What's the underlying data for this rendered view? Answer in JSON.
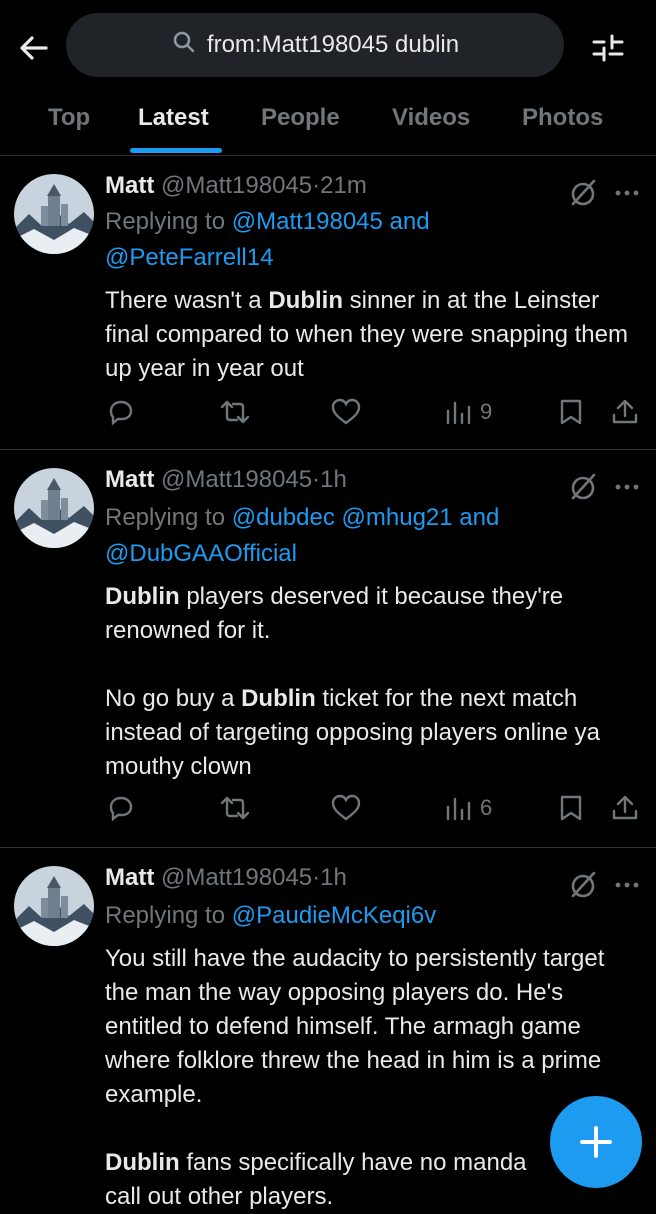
{
  "search": {
    "query": "from:Matt198045 dublin"
  },
  "tabs": [
    {
      "label": "Top"
    },
    {
      "label": "Latest"
    },
    {
      "label": "People"
    },
    {
      "label": "Videos"
    },
    {
      "label": "Photos"
    }
  ],
  "active_tab": "Latest",
  "tweets": [
    {
      "name": "Matt",
      "handle": "@Matt198045",
      "sep": "·",
      "time": "21m",
      "replying_prefix": "Replying to",
      "mentions": [
        "@Matt198045",
        "@PeteFarrell14"
      ],
      "connector": "and",
      "paragraphs": [
        [
          "There wasn't a ",
          "Dublin",
          " sinner in at the Leinster final compared to when they were snapping them up year in year out"
        ]
      ],
      "views": "9"
    },
    {
      "name": "Matt",
      "handle": "@Matt198045",
      "sep": "·",
      "time": "1h",
      "replying_prefix": "Replying to",
      "mentions": [
        "@dubdec",
        "@mhug21",
        "@DubGAAOfficial"
      ],
      "connector": "and",
      "paragraphs": [
        [
          "",
          "Dublin",
          " players deserved it because they're renowned for it."
        ],
        [
          "No go buy a ",
          "Dublin",
          " ticket for the next match instead of targeting opposing players online ya mouthy clown"
        ]
      ],
      "views": "6"
    },
    {
      "name": "Matt",
      "handle": "@Matt198045",
      "sep": "·",
      "time": "1h",
      "replying_prefix": "Replying to",
      "mentions": [
        "@PaudieMcKeqi6v"
      ],
      "connector": "",
      "paragraphs": [
        [
          "You still have the audacity to persistently target the man the way opposing players do. He's entitled to defend himself. The armagh game where folklore threw the head in him is a  prime example."
        ],
        [
          "",
          "Dublin",
          " fans specifically have no manda",
          "call out other players."
        ]
      ],
      "views": ""
    }
  ],
  "colors": {
    "accent": "#1d9bf0",
    "muted": "#71767b",
    "text": "#e7e9ea",
    "divider": "#2f3336"
  },
  "icons": [
    "back-arrow-icon",
    "search-icon",
    "filter-icon",
    "grok-icon",
    "more-icon",
    "reply-icon",
    "retweet-icon",
    "like-icon",
    "views-icon",
    "bookmark-icon",
    "share-icon",
    "compose-plus-icon"
  ]
}
